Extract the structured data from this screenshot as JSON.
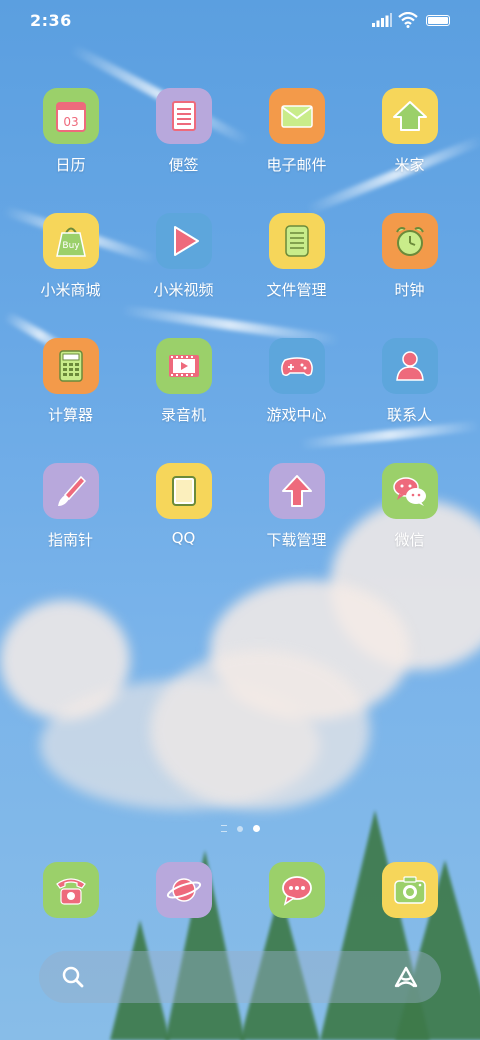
{
  "status_bar": {
    "time": "2:36"
  },
  "apps": [
    {
      "label": "日历",
      "icon": "calendar-icon",
      "color": "#9bd06a",
      "badge": "03"
    },
    {
      "label": "便签",
      "icon": "notes-icon",
      "color": "#b8a8dc"
    },
    {
      "label": "电子邮件",
      "icon": "mail-icon",
      "color": "#f39a4a"
    },
    {
      "label": "米家",
      "icon": "home-icon",
      "color": "#f6d65a"
    },
    {
      "label": "小米商城",
      "icon": "shopping-bag-icon",
      "color": "#f6d65a",
      "badge": "Buy"
    },
    {
      "label": "小米视频",
      "icon": "play-icon",
      "color": "#5da6dc"
    },
    {
      "label": "文件管理",
      "icon": "document-icon",
      "color": "#f6d65a"
    },
    {
      "label": "时钟",
      "icon": "alarm-clock-icon",
      "color": "#f39a4a"
    },
    {
      "label": "计算器",
      "icon": "calculator-icon",
      "color": "#f39a4a"
    },
    {
      "label": "录音机",
      "icon": "film-play-icon",
      "color": "#9bd06a"
    },
    {
      "label": "游戏中心",
      "icon": "gamepad-icon",
      "color": "#5da6dc"
    },
    {
      "label": "联系人",
      "icon": "person-icon",
      "color": "#5da6dc"
    },
    {
      "label": "指南针",
      "icon": "brush-icon",
      "color": "#b8a8dc"
    },
    {
      "label": "QQ",
      "icon": "tablet-icon",
      "color": "#f6d65a"
    },
    {
      "label": "下载管理",
      "icon": "arrow-up-icon",
      "color": "#b8a8dc"
    },
    {
      "label": "微信",
      "icon": "chat-bubbles-icon",
      "color": "#9bd06a"
    }
  ],
  "dock": [
    {
      "name": "phone-app",
      "icon": "telephone-icon",
      "color": "#9bd06a"
    },
    {
      "name": "browser-app",
      "icon": "planet-icon",
      "color": "#b8a8dc"
    },
    {
      "name": "messages-app",
      "icon": "chat-icon",
      "color": "#9bd06a"
    },
    {
      "name": "camera-app",
      "icon": "camera-icon",
      "color": "#f6d65a"
    }
  ],
  "page_indicator": {
    "pages": 3,
    "current": 3
  },
  "search": {
    "left_icon": "search-icon",
    "right_icon": "assistant-icon"
  }
}
